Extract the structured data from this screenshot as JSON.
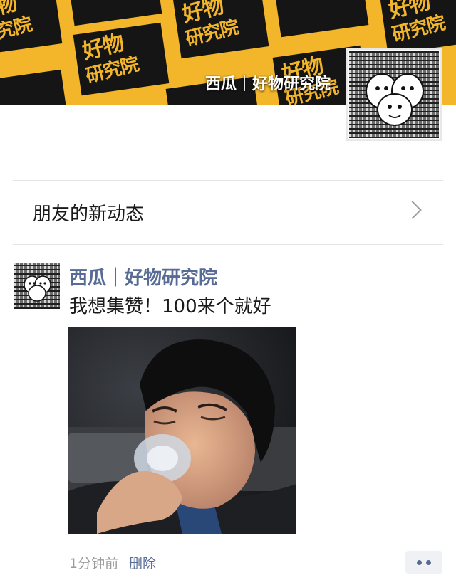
{
  "cover": {
    "brand_line1": "好物",
    "brand_line2": "研究院",
    "account_name": "西瓜｜好物研究院"
  },
  "friends_updates": {
    "label": "朋友的新动态"
  },
  "post": {
    "author": "西瓜｜好物研究院",
    "text": "我想集赞！100来个就好",
    "time": "1分钟前",
    "delete_label": "删除"
  },
  "colors": {
    "link_blue": "#576b95",
    "cover_yellow": "#f3b62b",
    "cover_black": "#151515"
  },
  "icons": [
    "chevron-right-icon",
    "more-dots-icon"
  ]
}
